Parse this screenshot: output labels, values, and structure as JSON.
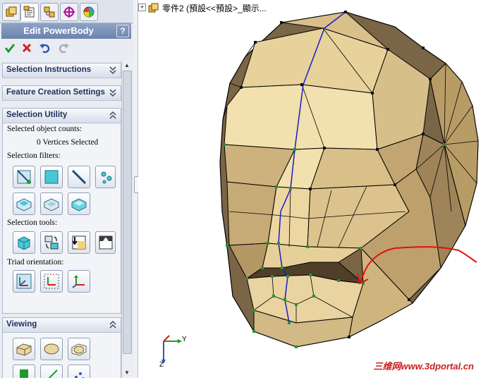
{
  "panel": {
    "tabs": [
      {
        "name": "feature-manager-tab-icon"
      },
      {
        "name": "property-manager-tab-icon"
      },
      {
        "name": "configuration-manager-tab-icon"
      },
      {
        "name": "dimxpert-tab-icon"
      },
      {
        "name": "display-manager-tab-icon"
      }
    ],
    "title": "Edit PowerBody",
    "help": "?",
    "groups": {
      "selection_instructions": "Selection Instructions",
      "feature_creation_settings": "Feature Creation Settings",
      "selection_utility": "Selection Utility",
      "viewing": "Viewing"
    },
    "selected_counts_label": "Selected object counts:",
    "selected_counts_value": "0 Vertices Selected",
    "selection_filters_label": "Selection filters:",
    "selection_tools_label": "Selection tools:",
    "triad_orientation_label": "Triad orientation:"
  },
  "tree": {
    "text": "零件2 (預設<<預設>_顯示..."
  },
  "axis": {
    "y": "Y",
    "z": "Z"
  },
  "watermark": "三维网www.3dportal.cn",
  "colors": {
    "face_light": "#ecd9a6",
    "face_mid": "#d9c08a",
    "face_dark": "#7a6546",
    "edge": "#000000",
    "seam": "#1a1acc",
    "annotation": "#e01010"
  }
}
